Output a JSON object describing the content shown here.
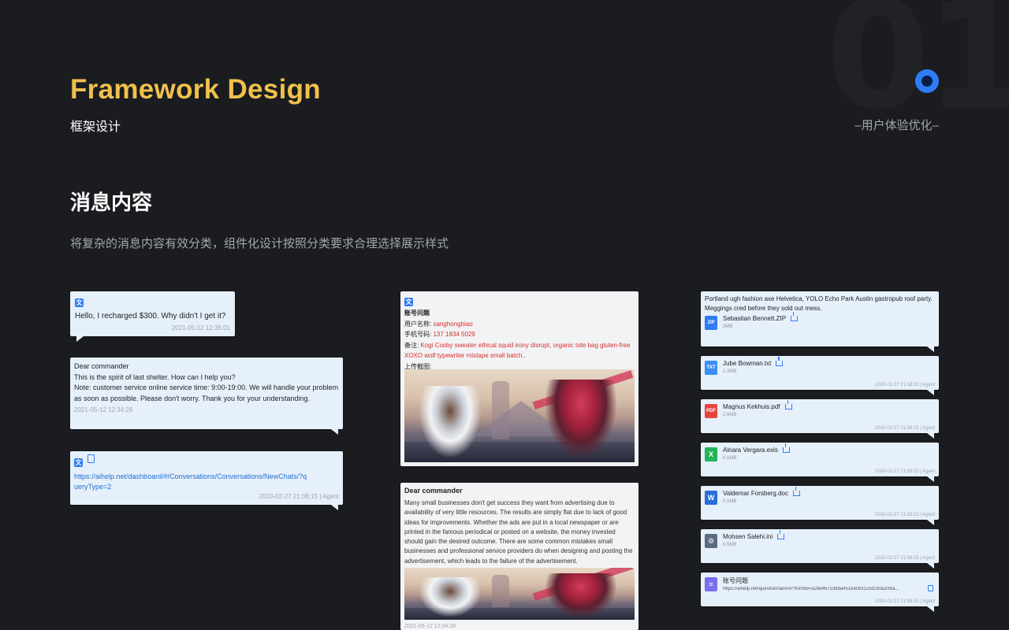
{
  "header": {
    "bg_number": "01",
    "title": "Framework Design",
    "subtitle": "框架设计",
    "tagline": "–用户体验优化–",
    "accent_color": "#f0c14b",
    "dot_color": "#2f7cf6"
  },
  "section": {
    "title": "消息内容",
    "description": "将复杂的消息内容有效分类，组件化设计按照分类要求合理选择展示样式"
  },
  "col1": {
    "msg1": {
      "text": "Hello, I recharged $300. Why didn't I get it?",
      "time": "2021-05-12   12:35:01"
    },
    "msg2": {
      "line1": "Dear commander",
      "line2": "This is the spirit of last shelter. How can I help you?",
      "line3": "Note: customer service online service time: 9:00-19:00. We will handle your problem as soon as possible. Please don't worry. Thank you for your understanding.",
      "time": "2021-05-12   12:34:28"
    },
    "msg3": {
      "link": "https://aihelp.net/dashboard/#/Conversations/Conversations/NewChats/?queryType=2",
      "meta": "2020-02-27 21:08:15 | Agent"
    }
  },
  "col2": {
    "form": {
      "title": "账号问题",
      "username_label": "用户名称:",
      "username_value": "sanghongbiao",
      "phone_label": "手机号码:",
      "phone_value": "137 1834 5029",
      "note_label": "备注:",
      "note_value": "Kogi Cosby sweater ethical squid irony disrupt, organic tote bag gluten-free XOXO wolf typewriter mixtape small batch..",
      "upload_label": "上传截图:"
    },
    "article": {
      "title": "Dear commander",
      "body": "Many small businesses don't get success they want from advertising due to availability of very little resources. The results are simply flat due to lack of good ideas for improvements. Whether the ads are put in a local newspaper or are printed in the famous periodical or posted on a website, the money invested should gain the desired outcome. There are some common mistakes small businesses and professional service providers do when designing and posting the advertisement, which leads to the failure of the advertisement.",
      "time": "2021-05-12   12:34:28"
    }
  },
  "col3": {
    "intro_text": "Portland ugh fashion axe Helvetica, YOLO Echo Park Austin gastropub roof party. Meggings cred before they sold out mess.",
    "files": [
      {
        "name": "Sebastian Bennett.ZIP",
        "size": "3MB",
        "icon": "ZIP",
        "icon_color": "#2f7cf6",
        "meta": ""
      },
      {
        "name": "Jube Bowman.txt",
        "size": "1.3MB",
        "icon": "TXT",
        "icon_color": "#3b8ef5",
        "meta": "2020-02-27 21:08:15 | Agent"
      },
      {
        "name": "Magnus Kekhuis.pdf",
        "size": "2.6MB",
        "icon": "PDF",
        "icon_color": "#e6453d",
        "meta": "2020-02-27 21:08:15 | Agent"
      },
      {
        "name": "Alnara Vergara.exls",
        "size": "0.1MB",
        "icon": "X",
        "icon_color": "#21b45a",
        "meta": "2020-02-27 21:08:15 | Agent"
      },
      {
        "name": "Valdemar Forsberg.doc",
        "size": "0.1MB",
        "icon": "W",
        "icon_color": "#2b6fd6",
        "meta": "2020-02-27 21:08:15 | Agent"
      },
      {
        "name": "Mohsen Salehi.ini",
        "size": "0.5MB",
        "icon": "⚙",
        "icon_color": "#5b6b82",
        "meta": "2020-02-27 21:08:15 | Agent"
      }
    ],
    "questionnaire": {
      "title": "账号问题",
      "link": "https://aihelp.net/questionnaire/#/?formId=a2de467536ba451e9c63125f230a2cf8a...",
      "meta": "2020-02-27 21:08:15 | Agent",
      "icon_color": "#7b6cf0"
    }
  }
}
